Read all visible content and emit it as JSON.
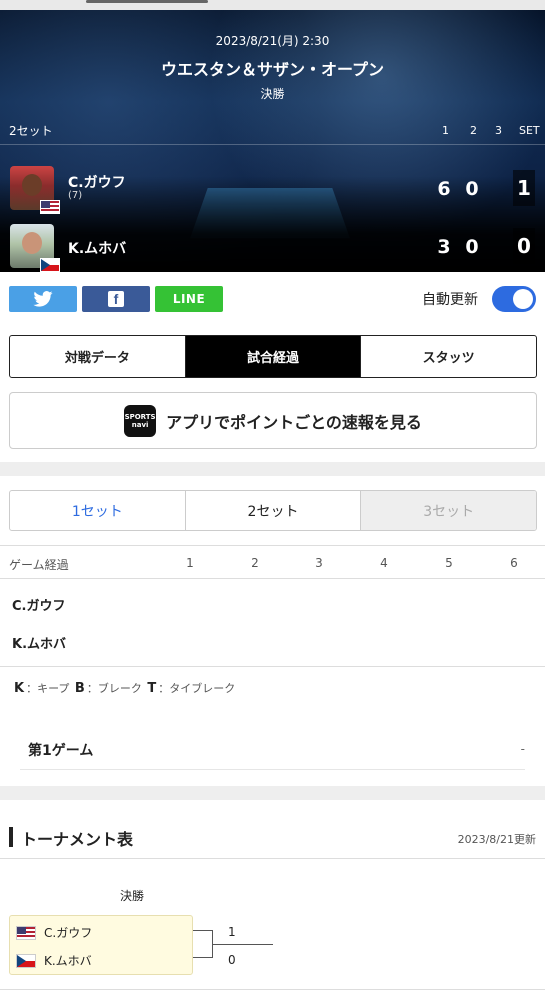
{
  "match": {
    "datetime": "2023/8/21(月) 2:30",
    "tournament": "ウエスタン＆サザン・オープン",
    "round": "決勝",
    "format": "2セット",
    "set_headers": [
      "1",
      "2",
      "3",
      "SET"
    ]
  },
  "players": [
    {
      "name": "C.ガウフ",
      "seed": "(7)",
      "country": "US",
      "games": [
        "6",
        "0"
      ],
      "sets": "1"
    },
    {
      "name": "K.ムホバ",
      "seed": "",
      "country": "CZ",
      "games": [
        "3",
        "0"
      ],
      "sets": "0"
    }
  ],
  "share": {
    "twitter": "twitter",
    "facebook": "f",
    "line": "LINE",
    "auto_update_label": "自動更新",
    "auto_update_on": true
  },
  "tabs": [
    "対戦データ",
    "試合経過",
    "スタッツ"
  ],
  "active_tab": "試合経過",
  "app_banner": {
    "logo": "SPORTS navi",
    "text": "アプリでポイントごとの速報を見る"
  },
  "set_tabs": [
    "1セット",
    "2セット",
    "3セット"
  ],
  "game_table": {
    "label": "ゲーム経過",
    "columns": [
      "1",
      "2",
      "3",
      "4",
      "5",
      "6"
    ],
    "rows": [
      "C.ガウフ",
      "K.ムホバ"
    ]
  },
  "legend": {
    "k": "K",
    "k_text": "：キープ",
    "b": "B",
    "b_text": "：ブレーク",
    "t": "T",
    "t_text": "：タイブレーク"
  },
  "game_detail": {
    "title": "第1ゲーム",
    "value": "-"
  },
  "tournament_table": {
    "title": "トーナメント表",
    "updated": "2023/8/21更新",
    "round": "決勝",
    "entries": [
      {
        "name": "C.ガウフ",
        "score": "1"
      },
      {
        "name": "K.ムホバ",
        "score": "0"
      }
    ]
  },
  "colors": {
    "accent": "#2d6be0",
    "twitter": "#4aa0e6",
    "facebook": "#3a5a98",
    "line": "#35c235"
  }
}
